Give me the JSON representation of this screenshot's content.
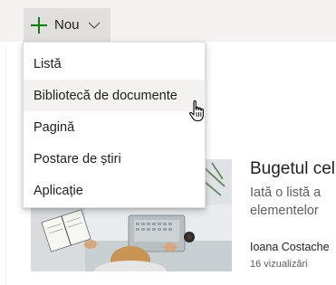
{
  "toolbar": {
    "new_label": "Nou"
  },
  "menu": {
    "items": [
      {
        "label": "Listă"
      },
      {
        "label": "Bibliotecă de documente"
      },
      {
        "label": "Pagină"
      },
      {
        "label": "Postare de știri"
      },
      {
        "label": "Aplicație"
      }
    ],
    "hovered_index": 1
  },
  "news_card": {
    "title": "Bugetul cel",
    "description_line1": "Iată o listă a",
    "description_line2": "elementelor",
    "author": "Ioana Costache",
    "views": "16 vizualizări"
  },
  "colors": {
    "accent_green": "#107c10",
    "toolbar_bg": "#f3f2f1",
    "button_bg": "#e1dfdd"
  },
  "icons": [
    "plus-icon",
    "chevron-down-icon",
    "hand-pointer-cursor-icon"
  ]
}
